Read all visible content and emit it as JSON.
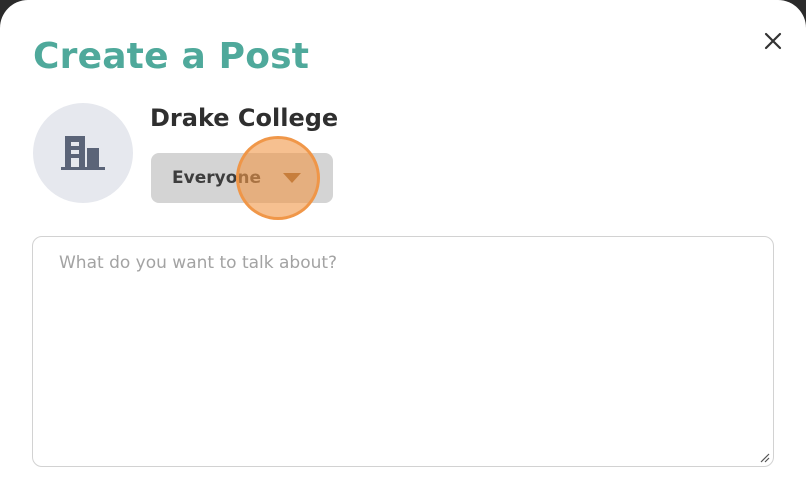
{
  "modal": {
    "title": "Create a Post",
    "close_icon": "close-icon"
  },
  "author": {
    "name": "Drake College",
    "avatar_icon": "building-icon"
  },
  "audience_select": {
    "selected": "Everyone",
    "icon": "caret-down-icon"
  },
  "post_input": {
    "value": "",
    "placeholder": "What do you want to talk about?"
  },
  "colors": {
    "title": "#4fa99b",
    "avatar_bg": "#e6e8ee",
    "avatar_icon": "#5b6478",
    "dropdown_bg": "#d4d4d4",
    "caret": "#8a5a2e",
    "cursor_highlight": "#f09646"
  }
}
